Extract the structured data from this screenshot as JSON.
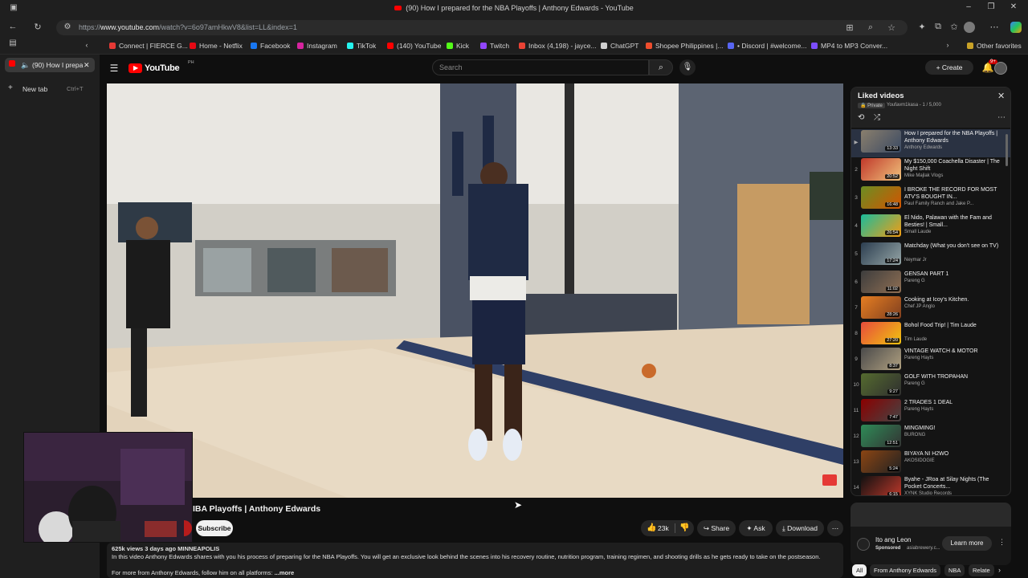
{
  "window": {
    "title": "(90) How I prepared for the NBA Playoffs | Anthony Edwards - YouTube"
  },
  "address_bar": {
    "url_prefix": "https://",
    "url_host": "www.youtube.com",
    "url_path": "/watch?v=6o97amHkwV8&list=LL&index=1"
  },
  "bookmarks": [
    {
      "label": "Connect | FIERCE G...",
      "color": "#e53935"
    },
    {
      "label": "Home - Netflix",
      "color": "#e50914"
    },
    {
      "label": "Facebook",
      "color": "#1877f2"
    },
    {
      "label": "Instagram",
      "color": "#d6249f"
    },
    {
      "label": "TikTok",
      "color": "#25f4ee"
    },
    {
      "label": "(140) YouTube",
      "color": "#ff0000"
    },
    {
      "label": "Kick",
      "color": "#53fc18"
    },
    {
      "label": "Twitch",
      "color": "#9146ff"
    },
    {
      "label": "Inbox (4,198) - jayce...",
      "color": "#ea4335"
    },
    {
      "label": "ChatGPT",
      "color": "#d0d0d0"
    },
    {
      "label": "Shopee Philippines |...",
      "color": "#ee4d2d"
    },
    {
      "label": "• Discord | #welcome...",
      "color": "#5865f2"
    },
    {
      "label": "MP4 to MP3 Conver...",
      "color": "#7c4dff"
    }
  ],
  "other_favorites": "Other favorites",
  "tabs": {
    "active": "(90) How I prepa",
    "new_tab": "New tab",
    "new_tab_shortcut": "Ctrl+T"
  },
  "youtube": {
    "logo": "YouTube",
    "logo_region": "PH",
    "search_placeholder": "Search",
    "create": "Create",
    "notif_count": "9+"
  },
  "video": {
    "title": "IBA Playoffs | Anthony Edwards",
    "subscribe": "Subscribe",
    "likes": "23k",
    "share": "Share",
    "ask": "Ask",
    "download": "Download",
    "desc_meta": "625k views  3 days ago  MINNEAPOLIS",
    "desc_line": "In this video Anthony Edwards shares with you his process of preparing for the NBA Playoffs. You will get an exclusive look behind the scenes into his recovery routine, nutrition program, training regimen, and shooting drills as he gets ready to take on the postseason.",
    "desc_more_prefix": "For more from Anthony Edwards, follow him on all platforms:",
    "desc_more": "...more"
  },
  "playlist": {
    "title": "Liked videos",
    "meta_private": "Private",
    "meta_owner": "Youfavm1kasa - 1 / 5,000",
    "items": [
      {
        "n": "▶",
        "title": "How I prepared for the NBA Playoffs | Anthony Edwards",
        "channel": "Anthony Edwards",
        "dur": "13:33",
        "c1": "#8a7f6d",
        "c2": "#3b4a63"
      },
      {
        "n": "2",
        "title": "My $150,000 Coachella Disaster | The Night Shift",
        "channel": "Mike Majlak Vlogs",
        "dur": "20:52",
        "c1": "#c0392b",
        "c2": "#f0c27b"
      },
      {
        "n": "3",
        "title": "I BROKE THE RECORD FOR MOST ATV'S BOUGHT IN...",
        "channel": "Paul Family Ranch and Jake P...",
        "dur": "16:48",
        "c1": "#6b8e23",
        "c2": "#d35400"
      },
      {
        "n": "4",
        "title": "El Nido, Palawan with the Fam and Besties! | Small...",
        "channel": "Small Laude",
        "dur": "26:54",
        "c1": "#1abc9c",
        "c2": "#f39c12"
      },
      {
        "n": "5",
        "title": "Matchday (What you don't see on TV)",
        "channel": "Neymar Jr",
        "dur": "17:24",
        "c1": "#2c3e50",
        "c2": "#95a5a6"
      },
      {
        "n": "6",
        "title": "GENSAN PART 1",
        "channel": "Pareng G",
        "dur": "11:02",
        "c1": "#3d3d3d",
        "c2": "#8e6e53"
      },
      {
        "n": "7",
        "title": "Cooking at Icoy's Kitchen.",
        "channel": "Chef JP Anglo",
        "dur": "28:26",
        "c1": "#e67e22",
        "c2": "#7f3f1f"
      },
      {
        "n": "8",
        "title": "Bohol Food Trip! | Tim Laude",
        "channel": "Tim Laude",
        "dur": "27:20",
        "c1": "#e74c3c",
        "c2": "#f1c40f"
      },
      {
        "n": "9",
        "title": "VINTAGE WATCH & MOTOR",
        "channel": "Pareng Hayts",
        "dur": "8:37",
        "c1": "#4a4a4a",
        "c2": "#b0a080"
      },
      {
        "n": "10",
        "title": "GOLF WITH TROPAHAN",
        "channel": "Pareng G",
        "dur": "9:27",
        "c1": "#556b2f",
        "c2": "#2f2f2f"
      },
      {
        "n": "11",
        "title": "2 TRADES 1 DEAL",
        "channel": "Pareng Hayts",
        "dur": "7:47",
        "c1": "#8b0000",
        "c2": "#444"
      },
      {
        "n": "12",
        "title": "MINGMING!",
        "channel": "BURONG",
        "dur": "12:51",
        "c1": "#2e8b57",
        "c2": "#333"
      },
      {
        "n": "13",
        "title": "BIYAYA NI H2WO",
        "channel": "AKOSIDOGIE",
        "dur": "5:24",
        "c1": "#8b4513",
        "c2": "#222"
      },
      {
        "n": "14",
        "title": "Byahe - JRoa at Silay Nights (The Pocket Concerts...",
        "channel": "XYNK Studio Records",
        "dur": "6:15",
        "c1": "#111",
        "c2": "#c0392b"
      }
    ]
  },
  "ad": {
    "brand": "Ito ang Leon",
    "sponsored": "Sponsored",
    "domain": "asiabrewery.c...",
    "cta": "Learn more"
  },
  "chips": [
    "All",
    "From Anthony Edwards",
    "NBA",
    "Relate"
  ]
}
